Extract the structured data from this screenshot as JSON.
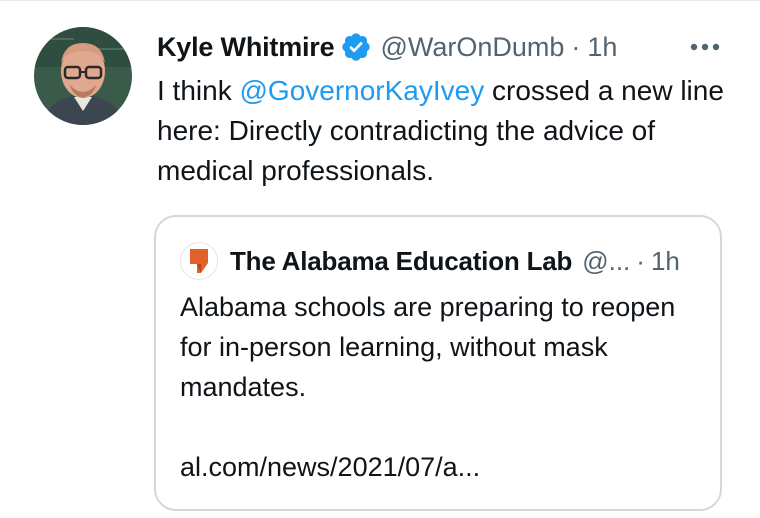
{
  "tweet": {
    "author": {
      "display_name": "Kyle Whitmire",
      "handle": "@WarOnDumb",
      "verified": true,
      "avatar": "profile-photo"
    },
    "time": "1h",
    "separator": "·",
    "more_icon": "more-horizontal-icon",
    "text_prefix": "I think ",
    "mention": "@GovernorKayIvey",
    "text_suffix": " crossed a new line here: Directly contradicting the advice of medical professionals."
  },
  "quoted_tweet": {
    "author": {
      "display_name": "The Alabama Education Lab",
      "handle": "@...",
      "avatar": "alabama-education-lab-logo"
    },
    "separator": "·",
    "time": "1h",
    "text": "Alabama schools are preparing to reopen for in-person learning, without mask mandates.",
    "link": "al.com/news/2021/07/a..."
  },
  "colors": {
    "text": "#0f1419",
    "secondary": "#536471",
    "link": "#1d9bf0",
    "verified": "#1d9bf0",
    "border": "#cfd9de",
    "logo_orange": "#e0622a"
  }
}
